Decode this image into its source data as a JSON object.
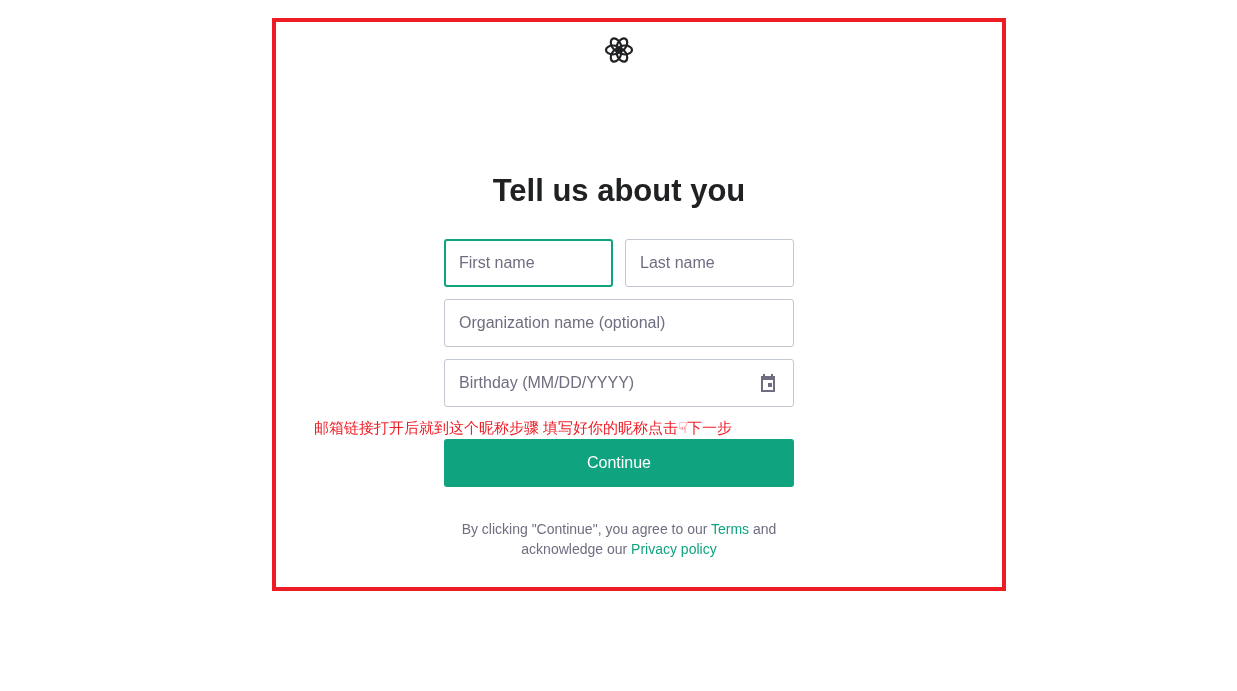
{
  "heading": "Tell us about you",
  "fields": [
    {
      "placeholder": "First name",
      "focused": true,
      "kind": "half"
    },
    {
      "placeholder": "Last name",
      "focused": false,
      "kind": "half"
    },
    {
      "placeholder": "Organization name (optional)",
      "focused": false,
      "kind": "full"
    },
    {
      "placeholder": "Birthday (MM/DD/YYYY)",
      "focused": false,
      "kind": "date"
    }
  ],
  "annotation": "邮箱链接打开后就到这个昵称步骤 填写好你的昵称点击☟下一步",
  "continue_button": "Continue",
  "legal": {
    "text_before": "By clicking \"Continue\", you agree to our",
    "terms_link": "Terms",
    "text_middle": "and acknowledge our",
    "privacy_link": "Privacy policy"
  }
}
